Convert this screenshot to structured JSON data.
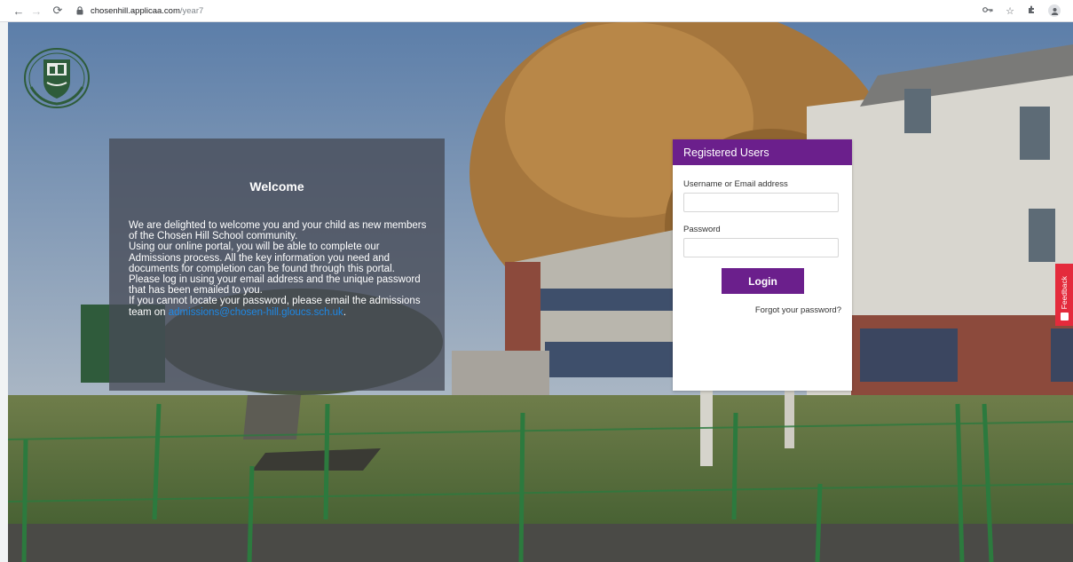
{
  "browser": {
    "url_host": "chosenhill.applicaa.com",
    "url_path": "/year7",
    "icons": [
      "back-arrow-icon",
      "forward-arrow-icon",
      "reload-icon",
      "lock-icon",
      "key-icon",
      "star-icon",
      "extensions-puzzle-icon",
      "profile-icon"
    ]
  },
  "welcome": {
    "title": "Welcome",
    "paragraphs": [
      "We are delighted to welcome you and your child as new members of the Chosen Hill School community.",
      "Using our online portal, you will be able to complete our Admissions process. All the key information you need and documents for completion can be found through this portal.",
      "Please log in using your email address and the unique password that has been emailed to you."
    ],
    "contact_text": "If you cannot locate your password, please email the admissions team on",
    "email": "admissions@chosen-hill.gloucs.sch.uk",
    "contact_end": "."
  },
  "login": {
    "header": "Registered Users",
    "username_label": "Username or Email address",
    "username_value": "",
    "password_label": "Password",
    "password_value": "",
    "button_label": "Login",
    "forgot_label": "Forgot your password?"
  },
  "feedback": {
    "label": "Feedback"
  },
  "colors": {
    "brand_purple": "#6b1f8c",
    "feedback_red": "#e42b3c",
    "link_blue": "#1e88e5",
    "crest_green": "#2e5c3a"
  }
}
